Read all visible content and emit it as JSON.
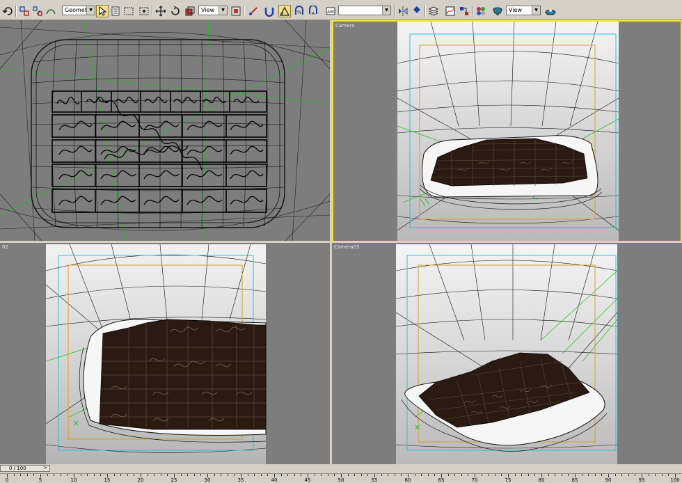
{
  "toolbar": {
    "selection_filter": "Geometry",
    "ref_coord_1": "View",
    "named_selection": "",
    "ref_coord_2": "View",
    "icons": [
      "undo-icon",
      "link-icon",
      "unlink-icon",
      "bind-space-warp-icon",
      "select-filter",
      "select-object-icon",
      "select-by-name-icon",
      "rect-region-icon",
      "window-crossing-icon",
      "select-move-icon",
      "select-rotate-icon",
      "select-scale-icon",
      "ref-coord-dropdown",
      "pivot-icon",
      "manipulate-icon",
      "snap-toggle-icon",
      "angle-snap-icon",
      "percent-snap-icon",
      "spinner-snap-icon",
      "edit-named-selection-icon",
      "named-selection-dropdown",
      "mirror-icon",
      "align-icon",
      "layer-manager-icon",
      "curve-editor-icon",
      "schematic-view-icon",
      "material-editor-icon",
      "render-scene-icon",
      "render-type-dropdown",
      "quick-render-icon"
    ]
  },
  "viewports": {
    "top_left": {
      "label": ""
    },
    "top_right": {
      "label": "Camera"
    },
    "bottom_left": {
      "label": "02"
    },
    "bottom_right": {
      "label": "Camera03"
    }
  },
  "timeslider": {
    "frame": "0 / 100"
  },
  "trackbar": {
    "labels": [
      "0",
      "5",
      "10",
      "15",
      "20",
      "25",
      "30",
      "35",
      "40",
      "45",
      "50",
      "55",
      "60",
      "65",
      "70",
      "75",
      "80",
      "85",
      "90",
      "95",
      "100"
    ]
  },
  "colors": {
    "active_viewport_border": "#f2e23a",
    "viewport_bg": "#7d7d7d",
    "chocolate": "#2a1a12",
    "safe_frame_cyan": "#22c4d8",
    "safe_frame_orange": "#d8a020",
    "grid_green": "#22cc22"
  }
}
